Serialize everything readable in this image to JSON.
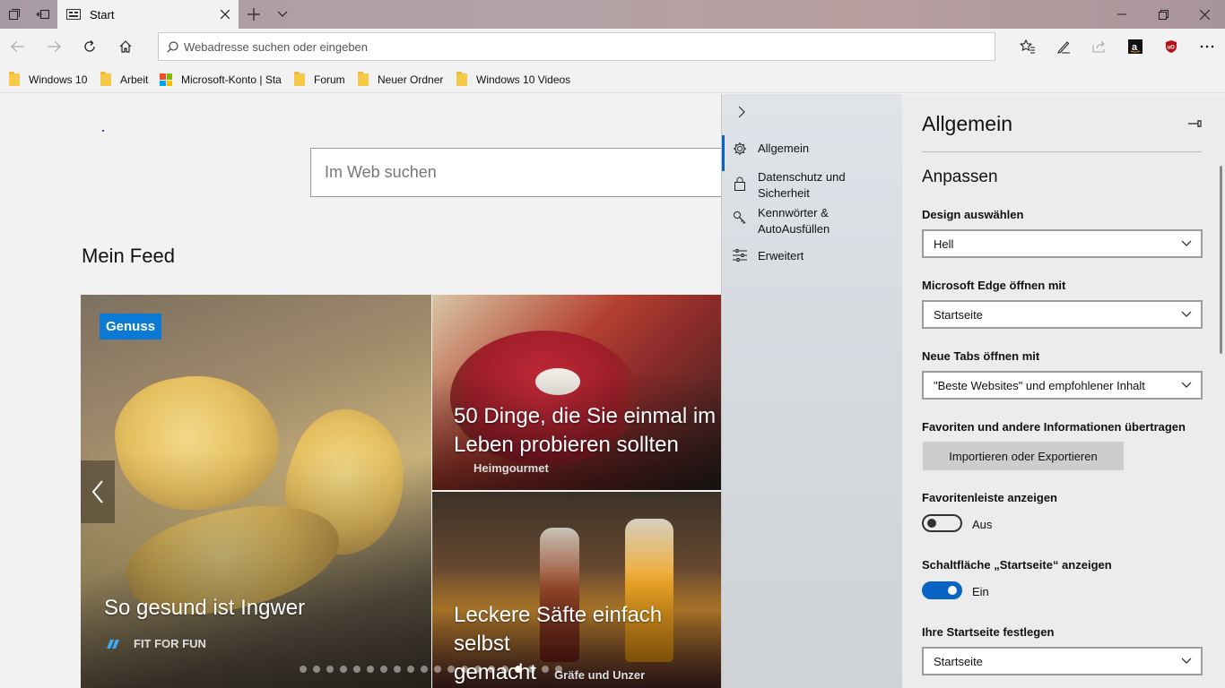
{
  "window": {
    "tab_title": "Start"
  },
  "address_bar": {
    "placeholder": "Webadresse suchen oder eingeben"
  },
  "favorites": [
    {
      "label": "Windows 10",
      "icon": "folder-icon"
    },
    {
      "label": "Arbeit",
      "icon": "folder-icon"
    },
    {
      "label": "Microsoft-Konto | Sta",
      "icon": "microsoft-logo-icon"
    },
    {
      "label": "Forum",
      "icon": "folder-icon"
    },
    {
      "label": "Neuer Ordner",
      "icon": "folder-icon"
    },
    {
      "label": "Windows 10 Videos",
      "icon": "folder-icon"
    }
  ],
  "newtab": {
    "search_placeholder": "Im Web suchen",
    "feed_title": "Mein Feed",
    "cards": [
      {
        "badge": "Genuss",
        "title": "So gesund ist Ingwer",
        "source": "FIT FOR FUN"
      },
      {
        "title_line1": "50 Dinge, die Sie einmal im",
        "title_line2": "Leben probieren sollten",
        "source": "Heimgourmet"
      },
      {
        "title_line1": "Leckere Säfte einfach selbst",
        "title_line2": "gemacht",
        "source": "Gräfe und Unzer"
      }
    ],
    "carousel": {
      "total": 20,
      "active_index": 16
    }
  },
  "settings_nav": {
    "items": [
      {
        "line1": "Allgemein",
        "line2": "",
        "icon": "gear-icon",
        "active": true
      },
      {
        "line1": "Datenschutz und",
        "line2": "Sicherheit",
        "icon": "lock-icon",
        "active": false
      },
      {
        "line1": "Kennwörter &",
        "line2": "AutoAusfüllen",
        "icon": "key-icon",
        "active": false
      },
      {
        "line1": "Erweitert",
        "line2": "",
        "icon": "sliders-icon",
        "active": false
      }
    ]
  },
  "settings": {
    "title": "Allgemein",
    "section": "Anpassen",
    "design_label": "Design auswählen",
    "design_value": "Hell",
    "open_with_label": "Microsoft Edge öffnen mit",
    "open_with_value": "Startseite",
    "new_tabs_label": "Neue Tabs öffnen mit",
    "new_tabs_value": "\"Beste Websites\" und empfohlener Inhalt",
    "transfer_label": "Favoriten und andere Informationen übertragen",
    "transfer_button": "Importieren oder Exportieren",
    "favbar_label": "Favoritenleiste anzeigen",
    "favbar_state": "Aus",
    "home_button_label": "Schaltfläche „Startseite“ anzeigen",
    "home_button_state": "Ein",
    "homepage_label": "Ihre Startseite festlegen",
    "homepage_value": "Startseite"
  },
  "colors": {
    "accent": "#0a64c4",
    "badge": "#0a7ad4"
  }
}
